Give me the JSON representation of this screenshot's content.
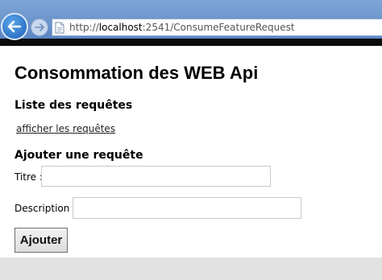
{
  "browser": {
    "url_prefix": "http://",
    "url_host": "localhost",
    "url_path": ":2541/ConsumeFeatureRequest",
    "back_icon": "back-arrow-icon",
    "forward_icon": "forward-arrow-icon",
    "page_icon": "page-icon"
  },
  "page": {
    "title": "Consommation des WEB Api",
    "list_heading": "Liste des requêtes",
    "list_link": "afficher les requêtes",
    "add_heading": "Ajouter une requête",
    "title_label": "Titre :",
    "title_value": "",
    "description_label": "Description :",
    "description_value": "",
    "submit_label": "Ajouter"
  },
  "colors": {
    "toolbar": "#5b86c4",
    "back_button": "#1d5fb8",
    "footer_band": "#e2e2e2"
  }
}
